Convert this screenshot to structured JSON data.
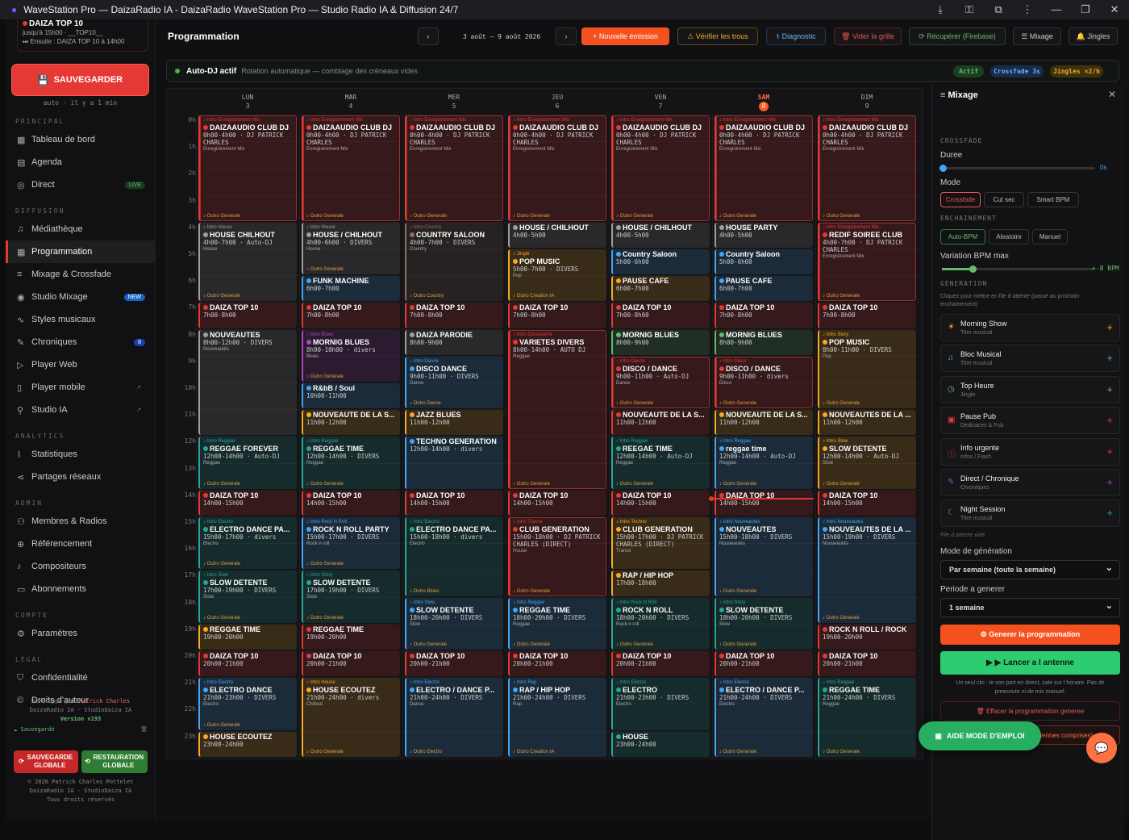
{
  "window": {
    "title": "WaveStation Pro — DaizaRadio IA - DaizaRadio WaveStation Pro — Studio Radio IA & Diffusion 24/7"
  },
  "sidebar": {
    "now": {
      "title": "DAIZA TOP 10",
      "line1": "jusqu'à 15h00 · __TOP10__",
      "line2": "⏭ Ensuite : DAIZA TOP 10 à 14h00"
    },
    "save": "SAUVEGARDER",
    "auto": "auto · il y a 1 min",
    "sections": {
      "principal": "PRINCIPAL",
      "diffusion": "DIFFUSION",
      "analytics": "ANALYTICS",
      "admin": "ADMIN",
      "compte": "COMPTE",
      "legal": "LÉGAL"
    },
    "nav": {
      "tableau": "Tableau de bord",
      "agenda": "Agenda",
      "direct": "Direct",
      "live": "LIVE",
      "mediatheque": "Médiathèque",
      "programmation": "Programmation",
      "mixage": "Mixage & Crossfade",
      "studio": "Studio Mixage",
      "new": "NEW",
      "styles": "Styles musicaux",
      "chroniques": "Chroniques",
      "chron_count": "8",
      "playerweb": "Player Web",
      "playermobile": "Player mobile",
      "studioia": "Studio IA",
      "stats": "Statistiques",
      "partages": "Partages réseaux",
      "membres": "Membres & Radios",
      "referencement": "Référencement",
      "compositeurs": "Compositeurs",
      "abonnements": "Abonnements",
      "parametres": "Paramètres",
      "confidentialite": "Confidentialité",
      "droits": "Droits d'auteur"
    },
    "foot": {
      "dev": "Développé par",
      "author": "Patrick Charles",
      "org": "DaizaRadio IA · StudioDaiza IA",
      "version": "Version v193",
      "saved": "Sauvegardé",
      "copy1": "© 2026 Patrick Charles Pottelet",
      "copy2": "DaizaRadio IA · StudioDaiza IA",
      "copy3": "Tous droits réservés"
    },
    "btn_save_global": "SAUVEGARDE GLOBALE",
    "btn_restore": "RESTAURATION GLOBALE"
  },
  "topbar": {
    "title": "Programmation",
    "range": "3 août — 9 août 2026",
    "new": "+ Nouvelle émission",
    "verify": "⚠ Vérifier les trous",
    "diag": "⚕ Diagnostic",
    "clear": "🗑 Vider la grille",
    "fetch": "⟳ Récupérer (Firebase)",
    "mix": "☰ Mixage",
    "jingles": "🔔 Jingles"
  },
  "autodj": {
    "title": "Auto-DJ actif",
    "desc": "Rotation automatique — comblage des créneaux vides",
    "p1": "Actif",
    "p2": "Crossfade 3s",
    "p3": "Jingles ×2/h"
  },
  "days": [
    {
      "n": "LUN",
      "d": "3"
    },
    {
      "n": "MAR",
      "d": "4"
    },
    {
      "n": "MER",
      "d": "5"
    },
    {
      "n": "JEU",
      "d": "6"
    },
    {
      "n": "VEN",
      "d": "7"
    },
    {
      "n": "SAM",
      "d": "8"
    },
    {
      "n": "DIM",
      "d": "9"
    }
  ],
  "hours": [
    "0h",
    "1h",
    "2h",
    "3h",
    "4h",
    "5h",
    "6h",
    "7h",
    "8h",
    "9h",
    "10h",
    "11h",
    "12h",
    "13h",
    "14h",
    "15h",
    "16h",
    "17h",
    "18h",
    "19h",
    "20h",
    "21h",
    "22h",
    "23h"
  ],
  "events": [
    [
      "0",
      "0",
      "4",
      "DAIZAAUDIO CLUB DJ",
      "0h00-4h00 · DJ PATRICK CHARLES",
      "♪ Intro Enregistrement Mix",
      "Enregistrement Mix",
      "♪ Outro Generale",
      "#e53935"
    ],
    [
      "1",
      "0",
      "4",
      "DAIZAAUDIO CLUB DJ",
      "0h00-4h00 · DJ PATRICK CHARLES",
      "♪ Intro Enregistrement Mix",
      "Enregistrement Mix",
      "♪ Outro Generale",
      "#e53935"
    ],
    [
      "2",
      "0",
      "4",
      "DAIZAAUDIO CLUB DJ",
      "0h00-4h00 · DJ PATRICK CHARLES",
      "♪ Intro Enregistrement Mix",
      "Enregistrement Mix",
      "♪ Outro Generale",
      "#e53935"
    ],
    [
      "3",
      "0",
      "4",
      "DAIZAAUDIO CLUB DJ",
      "0h00-4h00 · DJ PATRICK CHARLES",
      "♪ Intro Enregistrement Mix",
      "Enregistrement Mix",
      "♪ Outro Generale",
      "#e53935"
    ],
    [
      "4",
      "0",
      "4",
      "DAIZAAUDIO CLUB DJ",
      "0h00-4h00 · DJ PATRICK CHARLES",
      "♪ Intro Enregistrement Mix",
      "Enregistrement Mix",
      "♪ Outro Generale",
      "#e53935"
    ],
    [
      "5",
      "0",
      "4",
      "DAIZAAUDIO CLUB DJ",
      "0h00-4h00 · DJ PATRICK CHARLES",
      "♪ Intro Enregistrement Mix",
      "Enregistrement Mix",
      "♪ Outro Generale",
      "#e53935"
    ],
    [
      "6",
      "0",
      "4",
      "DAIZAAUDIO CLUB DJ",
      "0h00-4h00 · DJ PATRICK CHARLES",
      "♪ Intro Enregistrement Mix",
      "Enregistrement Mix",
      "♪ Outro Generale",
      "#e53935"
    ],
    [
      "0",
      "4",
      "7",
      "HOUSE CHILHOUT",
      "4h00-7h00 · Auto-DJ",
      "♪ Intro House",
      "House",
      "♪ Outro Generale",
      "#9e9e9e"
    ],
    [
      "1",
      "4",
      "6",
      "HOUSE / CHILHOUT",
      "4h00-6h00 · DIVERS",
      "♪ Intro House",
      "House",
      "♪ Outro Generale",
      "#9e9e9e"
    ],
    [
      "2",
      "4",
      "7",
      "COUNTRY SALOON",
      "4h00-7h00 · DIVERS",
      "♪ Intro Country",
      "Country",
      "♪ Outro Country",
      "#8d6e63"
    ],
    [
      "3",
      "4",
      "5",
      "HOUSE / CHILHOUT",
      "4h00-5h00",
      "",
      "",
      "",
      "#9e9e9e"
    ],
    [
      "4",
      "4",
      "5",
      "HOUSE / CHILHOUT",
      "4h00-5h00",
      "",
      "",
      "",
      "#9e9e9e"
    ],
    [
      "5",
      "4",
      "5",
      "HOUSE PARTY",
      "4h00-5h00",
      "",
      "",
      "",
      "#9e9e9e"
    ],
    [
      "6",
      "4",
      "7",
      "REDIF SOIREE CLUB",
      "4h00-7h00 · DJ PATRICK CHARLES",
      "♪ Intro Enregistrement Mix",
      "Enregistrement Mix",
      "♪ Outro Generale",
      "#e53935"
    ],
    [
      "3",
      "5",
      "7",
      "POP MUSIC",
      "5h00-7h00 · DIVERS",
      "♪ Jingle",
      "Pop",
      "♪ Outro Creation IA",
      "#f9a825"
    ],
    [
      "4",
      "5",
      "6",
      "Country Saloon",
      "5h00-6h00",
      "",
      "",
      "",
      "#42a5f5"
    ],
    [
      "5",
      "5",
      "6",
      "Country Saloon",
      "5h00-6h00",
      "",
      "",
      "",
      "#42a5f5"
    ],
    [
      "1",
      "6",
      "7",
      "FUNK MACHINE",
      "6h00-7h00",
      "",
      "",
      "",
      "#42a5f5"
    ],
    [
      "4",
      "6",
      "7",
      "PAUSE CAFE",
      "6h00-7h00",
      "",
      "",
      "",
      "#f9a825"
    ],
    [
      "5",
      "6",
      "7",
      "PAUSE CAFE",
      "6h00-7h00",
      "",
      "",
      "",
      "#42a5f5"
    ],
    [
      "0",
      "7",
      "8",
      "DAIZA TOP 10",
      "7h00-8h00",
      "",
      "",
      "",
      "#e53935"
    ],
    [
      "1",
      "7",
      "8",
      "DAIZA TOP 10",
      "7h00-8h00",
      "",
      "",
      "",
      "#e53935"
    ],
    [
      "2",
      "7",
      "8",
      "DAIZA TOP 10",
      "7h00-8h00",
      "",
      "",
      "",
      "#e53935"
    ],
    [
      "3",
      "7",
      "8",
      "DAIZA TOP 10",
      "7h00-8h00",
      "",
      "",
      "",
      "#e53935"
    ],
    [
      "4",
      "7",
      "8",
      "DAIZA TOP 10",
      "7h00-8h00",
      "",
      "",
      "",
      "#e53935"
    ],
    [
      "5",
      "7",
      "8",
      "DAIZA TOP 10",
      "7h00-8h00",
      "",
      "",
      "",
      "#e53935"
    ],
    [
      "6",
      "7",
      "8",
      "DAIZA TOP 10",
      "7h00-8h00",
      "",
      "",
      "",
      "#e53935"
    ],
    [
      "0",
      "8",
      "12",
      "NOUVEAUTES",
      "8h00-12h00 · DIVERS",
      "",
      "Nouveautés",
      "",
      "#9e9e9e"
    ],
    [
      "1",
      "8",
      "10",
      "MORNIG BLUES",
      "8h00-10h00 · divers",
      "♪ Intro Blues",
      "Blues",
      "♪ Outro Generale",
      "#ab47bc"
    ],
    [
      "2",
      "8",
      "9",
      "DAIZA PARODIE",
      "8h00-9h00",
      "",
      "",
      "",
      "#9e9e9e"
    ],
    [
      "3",
      "8",
      "14",
      "VARIETES DIVERS",
      "8h00-14h00 · AUTO DJ",
      "♪ Intro Découverte",
      "Reggae",
      "♪ Outro Generale",
      "#e53935"
    ],
    [
      "4",
      "8",
      "9",
      "MORNIG BLUES",
      "8h00-9h00",
      "",
      "",
      "",
      "#66bb6a"
    ],
    [
      "5",
      "8",
      "9",
      "MORNIG BLUES",
      "8h00-9h00",
      "",
      "",
      "",
      "#66bb6a"
    ],
    [
      "6",
      "8",
      "11",
      "POP MUSIC",
      "8h00-11h00 · DIVERS",
      "♪ Intro Story",
      "Pop",
      "♪ Outro Generale",
      "#f9a825"
    ],
    [
      "2",
      "9",
      "11",
      "DISCO DANCE",
      "9h00-11h00 · DIVERS",
      "♪ Intro Dance",
      "Dance",
      "♪ Outro Dance",
      "#42a5f5"
    ],
    [
      "4",
      "9",
      "11",
      "DISCO / DANCE",
      "9h00-11h00 · Auto-DJ",
      "♪ Intro Dance",
      "Dance",
      "♪ Outro Generale",
      "#e53935"
    ],
    [
      "5",
      "9",
      "11",
      "DISCO / DANCE",
      "9h00-11h00 · divers",
      "♪ Intro Disco",
      "Disco",
      "♪ Outro Generale",
      "#e53935"
    ],
    [
      "1",
      "10",
      "11",
      "R&bB / Soul",
      "10h00-11h00",
      "",
      "",
      "",
      "#42a5f5"
    ],
    [
      "1",
      "11",
      "12",
      "NOUVEAUTE DE LA S...",
      "11h00-12h00",
      "",
      "",
      "",
      "#f9a825"
    ],
    [
      "2",
      "11",
      "12",
      "JAZZ BLUES",
      "11h00-12h00",
      "",
      "",
      "",
      "#f9a825"
    ],
    [
      "4",
      "11",
      "12",
      "NOUVEAUTE DE LA S...",
      "11h00-12h00",
      "",
      "",
      "",
      "#e53935"
    ],
    [
      "5",
      "11",
      "12",
      "NOUVEAUTE DE LA S...",
      "11h00-12h00",
      "",
      "",
      "",
      "#f9a825"
    ],
    [
      "6",
      "11",
      "12",
      "NOUVEAUTES DE LA ...",
      "11h00-12h00",
      "",
      "",
      "",
      "#f9a825"
    ],
    [
      "0",
      "12",
      "14",
      "REGGAE FOREVER",
      "12h00-14h00 · Auto-DJ",
      "♪ Intro Reggae",
      "Reggae",
      "♪ Outro Generale",
      "#26a69a"
    ],
    [
      "1",
      "12",
      "14",
      "REGGAE TIME",
      "12h00-14h00 · DIVERS",
      "♪ Intro Reggae",
      "Reggae",
      "♪ Outro Generale",
      "#26a69a"
    ],
    [
      "2",
      "12",
      "14",
      "TECHNO GENERATION",
      "12h00-14h00 · divers",
      "",
      "",
      "",
      "#42a5f5"
    ],
    [
      "4",
      "12",
      "14",
      "REEGAE TIME",
      "12h00-14h00 · Auto-DJ",
      "♪ Intro Reggae",
      "Reggae",
      "♪ Outro Generale",
      "#26a69a"
    ],
    [
      "5",
      "12",
      "14",
      "reggae time",
      "12h00-14h00 · Auto-DJ",
      "♪ Intro Reggae",
      "Reggae",
      "♪ Outro Generale",
      "#42a5f5"
    ],
    [
      "6",
      "12",
      "14",
      "SLOW DETENTE",
      "12h00-14h00 · Auto-DJ",
      "♪ Intro Slow",
      "Slow",
      "♪ Outro Generale",
      "#f9a825"
    ],
    [
      "0",
      "14",
      "15",
      "DAIZA TOP 10",
      "14h00-15h00",
      "",
      "",
      "",
      "#e53935"
    ],
    [
      "1",
      "14",
      "15",
      "DAIZA TOP 10",
      "14h00-15h00",
      "",
      "",
      "",
      "#e53935"
    ],
    [
      "2",
      "14",
      "15",
      "DAIZA TOP 10",
      "14h00-15h00",
      "",
      "",
      "",
      "#e53935"
    ],
    [
      "3",
      "14",
      "15",
      "DAIZA TOP 10",
      "14h00-15h00",
      "",
      "",
      "",
      "#e53935"
    ],
    [
      "4",
      "14",
      "15",
      "DAIZA TOP 10",
      "14h00-15h00",
      "",
      "",
      "",
      "#e53935"
    ],
    [
      "5",
      "14",
      "15",
      "DAIZA TOP 10",
      "14h00-15h00",
      "",
      "",
      "",
      "#e53935"
    ],
    [
      "6",
      "14",
      "15",
      "DAIZA TOP 10",
      "14h00-15h00",
      "",
      "",
      "",
      "#e53935"
    ],
    [
      "0",
      "15",
      "17",
      "ELECTRO DANCE PA...",
      "15h00-17h00 · divers",
      "♪ Intro Electro",
      "Electro",
      "♪ Outro Generale",
      "#26a69a"
    ],
    [
      "1",
      "15",
      "17",
      "ROCK N ROLL PARTY",
      "15h00-17h00 · DIVERS",
      "♪ Intro Rock N Roll",
      "Rock n roll",
      "♪ Outro Generale",
      "#42a5f5"
    ],
    [
      "2",
      "15",
      "18",
      "ELECTRO DANCE PA...",
      "15h00-18h00 · divers",
      "♪ Intro Electro",
      "Electro",
      "♪ Outro Blues",
      "#26a69a"
    ],
    [
      "3",
      "15",
      "18",
      "CLUB GENERATION",
      "15h00-18h00 · DJ PATRICK CHARLES (DIRECT)",
      "♪ Intro Trance",
      "House",
      "♪ Outro Generale",
      "#e53935"
    ],
    [
      "4",
      "15",
      "17",
      "CLUB GENERATION",
      "15h00-17h00 · DJ PATRICK CHARLES (DIRECT)",
      "♪ Intro Techno",
      "Trance",
      "",
      "#f9a825"
    ],
    [
      "5",
      "15",
      "18",
      "NOUVEAUTES",
      "15h00-18h00 · DIVERS",
      "♪ Intro Nouveautes",
      "Nouveautés",
      "♪ Outro Generale",
      "#42a5f5"
    ],
    [
      "6",
      "15",
      "19",
      "NOUVEAUTES DE LA ...",
      "15h00-19h00 · DIVERS",
      "♪ Intro Nouveautes",
      "Nouveautés",
      "♪ Outro Generale",
      "#42a5f5"
    ],
    [
      "4",
      "17",
      "18",
      "RAP / HIP HOP",
      "17h00-18h00",
      "",
      "",
      "",
      "#f9a825"
    ],
    [
      "0",
      "17",
      "19",
      "SLOW DETENTE",
      "17h00-19h00 · DIVERS",
      "♪ Intro Slow",
      "Slow",
      "♪ Outro Generale",
      "#26a69a"
    ],
    [
      "1",
      "17",
      "19",
      "SLOW DETENTE",
      "17h00-19h00 · DIVERS",
      "♪ Intro Story",
      "Slow",
      "♪ Outro Generale",
      "#26a69a"
    ],
    [
      "2",
      "18",
      "20",
      "SLOW DETENTE",
      "18h00-20h00 · DIVERS",
      "♪ Intro Slow",
      "Slow",
      "♪ Outro Generale",
      "#42a5f5"
    ],
    [
      "3",
      "18",
      "20",
      "REGGAE TIME",
      "18h00-20h00 · DIVERS",
      "♪ Intro Reggae",
      "Reggae",
      "♪ Outro Generale",
      "#42a5f5"
    ],
    [
      "4",
      "18",
      "20",
      "ROCK N ROLL",
      "18h00-20h00 · DIVERS",
      "♪ Intro Rock N Roll",
      "Rock n roll",
      "♪ Outro Generale",
      "#26a69a"
    ],
    [
      "5",
      "18",
      "20",
      "SLOW DETENTE",
      "18h00-20h00 · DIVERS",
      "♪ Intro Story",
      "Slow",
      "♪ Outro Generale",
      "#26a69a"
    ],
    [
      "0",
      "19",
      "20",
      "REGGAE TIME",
      "19h00-20h00",
      "",
      "",
      "",
      "#f9a825"
    ],
    [
      "1",
      "19",
      "20",
      "REGGAE TIME",
      "19h00-20h00",
      "",
      "",
      "",
      "#e53935"
    ],
    [
      "6",
      "19",
      "20",
      "ROCK N ROLL / ROCK",
      "19h00-20h00",
      "",
      "",
      "",
      "#e53935"
    ],
    [
      "0",
      "20",
      "21",
      "DAIZA TOP 10",
      "20h00-21h00",
      "",
      "",
      "",
      "#e53935"
    ],
    [
      "1",
      "20",
      "21",
      "DAIZA TOP 10",
      "20h00-21h00",
      "",
      "",
      "",
      "#e53935"
    ],
    [
      "2",
      "20",
      "21",
      "DAIZA TOP 10",
      "20h00-21h00",
      "",
      "",
      "",
      "#e53935"
    ],
    [
      "3",
      "20",
      "21",
      "DAIZA TOP 10",
      "20h00-21h00",
      "",
      "",
      "",
      "#e53935"
    ],
    [
      "4",
      "20",
      "21",
      "DAIZA TOP 10",
      "20h00-21h00",
      "",
      "",
      "",
      "#e53935"
    ],
    [
      "5",
      "20",
      "21",
      "DAIZA TOP 10",
      "20h00-21h00",
      "",
      "",
      "",
      "#e53935"
    ],
    [
      "6",
      "20",
      "21",
      "DAIZA TOP 10",
      "20h00-21h00",
      "",
      "",
      "",
      "#e53935"
    ],
    [
      "0",
      "21",
      "23",
      "ELECTRO DANCE",
      "21h00-23h00 · DIVERS",
      "♪ Intro Electro",
      "Electro",
      "♪ Outro Generale",
      "#42a5f5"
    ],
    [
      "1",
      "21",
      "24",
      "HOUSE ECOUTEZ",
      "21h00-24h00 · divers",
      "♪ Intro House",
      "Chillout",
      "♪ Outro Generale",
      "#f9a825"
    ],
    [
      "2",
      "21",
      "24",
      "ELECTRO / DANCE P...",
      "21h00-24h00 · DIVERS",
      "♪ Intro Electro",
      "Dance",
      "♪ Outro Electro",
      "#42a5f5"
    ],
    [
      "3",
      "21",
      "24",
      "RAP / HIP HOP",
      "21h00-24h00 · DIVERS",
      "♪ Intro Rap",
      "Rap",
      "♪ Outro Creation IA",
      "#42a5f5"
    ],
    [
      "4",
      "21",
      "23",
      "ELECTRO",
      "21h00-23h00 · DIVERS",
      "♪ Intro Electro",
      "Electro",
      "",
      "#26a69a"
    ],
    [
      "5",
      "21",
      "24",
      "ELECTRO / DANCE P...",
      "21h00-24h00 · DIVERS",
      "♪ Intro Electro",
      "Electro",
      "♪ Outro Generale",
      "#42a5f5"
    ],
    [
      "6",
      "21",
      "24",
      "REGGAE TIME",
      "21h00-24h00 · DIVERS",
      "♪ Intro Reggae",
      "Reggae",
      "♪ Outro Generale",
      "#26a69a"
    ],
    [
      "0",
      "23",
      "24",
      "HOUSE ECOUTEZ",
      "23h00-24h00",
      "",
      "",
      "",
      "#f9a825"
    ],
    [
      "4",
      "23",
      "24",
      "HOUSE",
      "23h00-24h00",
      "",
      "",
      "",
      "#26a69a"
    ]
  ],
  "panel": {
    "title": "Mixage",
    "crossfade": "CROSSFADE",
    "duree": "Duree",
    "duree_val": "0s",
    "mode": "Mode",
    "modes": [
      "Crossfade",
      "Cut sec",
      "Smart BPM"
    ],
    "enchainement": "ENCHAINEMENT",
    "enchs": [
      "Auto-BPM",
      "Aleatoire",
      "Manuel"
    ],
    "bpm": "Variation BPM max",
    "bpm_val": "+-8 BPM",
    "generation": "GENERATION",
    "gen_desc": "Cliquez pour mettre en file d attente (passe au prochain enchainement)",
    "items": [
      {
        "t": "Morning Show",
        "s": "Titre musical",
        "i": "☀",
        "c": "#f9a825"
      },
      {
        "t": "Bloc Musical",
        "s": "Titre musical",
        "i": "♫",
        "c": "#42a5f5"
      },
      {
        "t": "Top Heure",
        "s": "Jingle",
        "i": "◷",
        "c": "#66bb6a"
      },
      {
        "t": "Pause Pub",
        "s": "Dedicaces & Pub",
        "i": "▣",
        "c": "#e53935"
      },
      {
        "t": "Info urgente",
        "s": "Infos / Flash",
        "i": "ⓘ",
        "c": "#e53935"
      },
      {
        "t": "Direct / Chronique",
        "s": "Chroniques",
        "i": "✎",
        "c": "#ab47bc"
      },
      {
        "t": "Night Session",
        "s": "Titre musical",
        "i": "☾",
        "c": "#26a69a"
      }
    ],
    "queue": "File d attente vide",
    "mode_gen": "Mode de génération",
    "mode_gen_val": "Par semaine (toute la semaine)",
    "periode": "Periode a generer",
    "periode_val": "1 semaine",
    "gen_btn": "⚙ Generer la programmation",
    "launch_btn": "▶ ▶ Lancer a l antenne",
    "launch_note": "Un seul clic : le son part en direct, cale sur l horaire. Pas de preecoute ni de mix manuel.",
    "erase": "🗑 Effacer la programmation generee",
    "erase_all": "🗑 ⚠ TOUT effacer (anciennes comprises)",
    "help": "AIDE MODE D'EMPLOI"
  }
}
